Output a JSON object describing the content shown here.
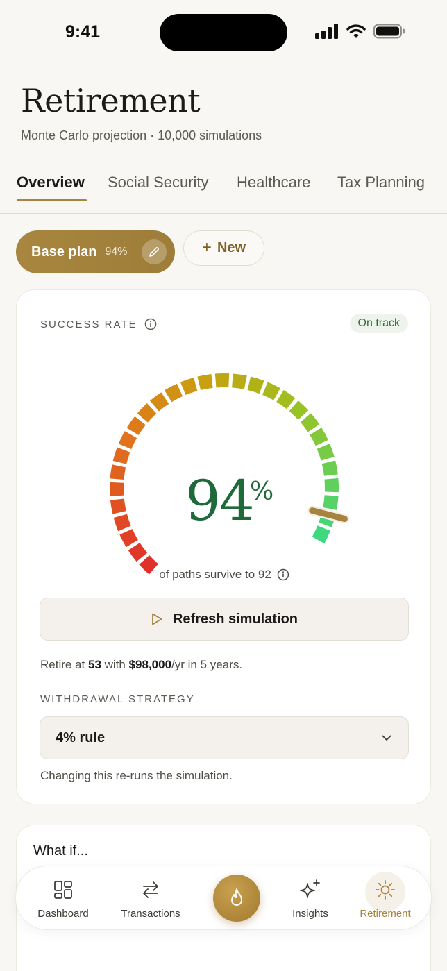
{
  "status_bar": {
    "time": "9:41"
  },
  "header": {
    "title": "Retirement",
    "subtitle": "Monte Carlo projection · 10,000 simulations"
  },
  "tabs": [
    {
      "label": "Overview",
      "active": true
    },
    {
      "label": "Social Security",
      "active": false
    },
    {
      "label": "Healthcare",
      "active": false
    },
    {
      "label": "Tax Planning",
      "active": false
    }
  ],
  "plans": {
    "base": {
      "label": "Base plan",
      "pct": "94%"
    },
    "new_label": "New"
  },
  "success_card": {
    "label": "SUCCESS RATE",
    "badge": "On track",
    "value": "94",
    "unit": "%",
    "value_fraction": 0.94,
    "caption": "of paths survive to 92",
    "refresh_label": "Refresh simulation",
    "retire_prefix": "Retire at ",
    "retire_age": "53",
    "retire_mid": " with ",
    "retire_amount": "$98,000",
    "retire_suffix": "/yr in 5 years.",
    "strategy_label": "WITHDRAWAL STRATEGY",
    "strategy_value": "4% rule",
    "strategy_help": "Changing this re-runs the simulation."
  },
  "whatif": {
    "title": "What if..."
  },
  "bottom_nav": [
    {
      "label": "Dashboard",
      "icon": "grid-icon"
    },
    {
      "label": "Transactions",
      "icon": "arrows-swap-icon"
    },
    {
      "label": "",
      "icon": "flame-icon"
    },
    {
      "label": "Insights",
      "icon": "sparkles-icon"
    },
    {
      "label": "Retirement",
      "icon": "sun-icon",
      "active": true
    }
  ],
  "colors": {
    "accent": "#a6843f",
    "success": "#1f6a3a",
    "gauge_start": "#e0302a",
    "gauge_end": "#3ed87f"
  }
}
